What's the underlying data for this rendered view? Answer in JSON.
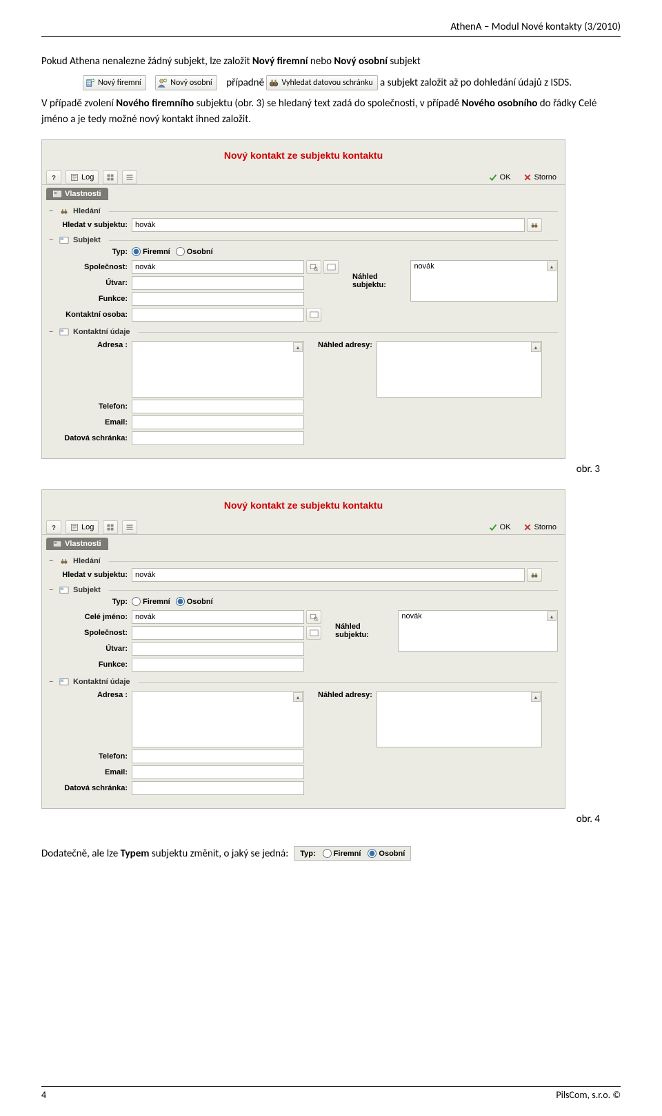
{
  "doc": {
    "header_right": "AthenA – Modul Nové kontakty (3/2010)",
    "para1_a": "Pokud Athena nenalezne žádný subjekt, lze založit ",
    "para1_b": "Nový firemní",
    "para1_c": " nebo ",
    "para1_d": "Nový osobní",
    "para1_e": " subjekt",
    "para2_a": "případně ",
    "para2_b": " a subjekt založit až po dohledání údajů z ISDS.",
    "para3_a": "V případě zvolení ",
    "para3_b": "Nového firemního",
    "para3_c": " subjektu (obr. 3) se hledaný text zadá do společnosti, v případě ",
    "para3_d": "Nového osobního",
    "para3_e": " do řádky Celé jméno a je tedy možné nový kontakt ihned založit.",
    "btn_novy_firemni": "Nový firemní",
    "btn_novy_osobni": "Nový osobní",
    "btn_vyhledat": "Vyhledat datovou schránku",
    "obr3": "obr. 3",
    "obr4": "obr. 4",
    "bottom_a": "Dodatečně, ale lze ",
    "bottom_b": "Typem",
    "bottom_c": " subjektu změnit, o jaký se jedná:",
    "page_num": "4",
    "copyright": "PilsCom, s.r.o. ©"
  },
  "common_labels": {
    "form_title": "Nový kontakt ze subjektu kontaktu",
    "log": "Log",
    "ok": "OK",
    "storno": "Storno",
    "tab": "Vlastnosti",
    "grp_hledani": "Hledání",
    "grp_subjekt": "Subjekt",
    "grp_kontakt": "Kontaktní údaje",
    "lbl_hledat": "Hledat v subjektu:",
    "lbl_typ": "Typ:",
    "opt_firemni": "Firemní",
    "opt_osobni": "Osobní",
    "lbl_spolecnost": "Společnost:",
    "lbl_cele_jmeno": "Celé jméno:",
    "lbl_utvar": "Útvar:",
    "lbl_funkce": "Funkce:",
    "lbl_kont_osoba": "Kontaktní osoba:",
    "lbl_nahled_subj": "Náhled subjektu:",
    "lbl_adresa": "Adresa :",
    "lbl_nahled_adr": "Náhled adresy:",
    "lbl_telefon": "Telefon:",
    "lbl_email": "Email:",
    "lbl_datschranka": "Datová schránka:"
  },
  "form1": {
    "search_value": "hovák",
    "typ_checked": "firemni",
    "spolecnost": "novák",
    "nahled_subj": "novák"
  },
  "form2": {
    "search_value": "novák",
    "typ_checked": "osobni",
    "cele_jmeno": "novák",
    "nahled_subj": "novák"
  },
  "type_chip": {
    "label": "Typ:",
    "opt_firemni": "Firemní",
    "opt_osobni": "Osobní"
  }
}
